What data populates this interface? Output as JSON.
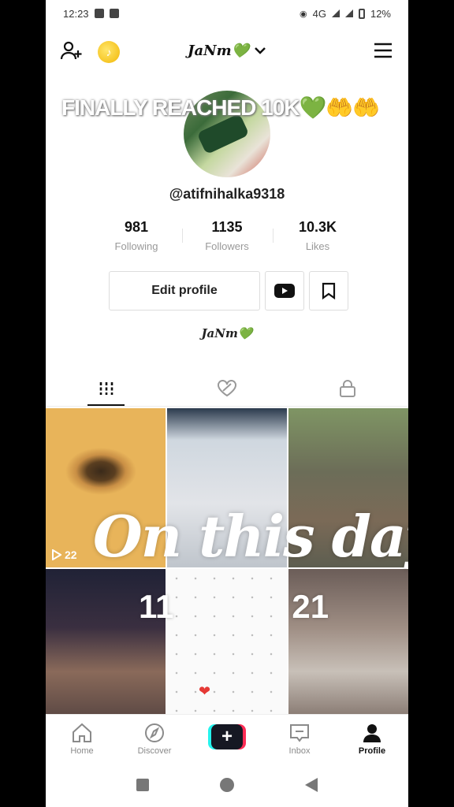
{
  "status_bar": {
    "time": "12:23",
    "network": "4G",
    "battery": "12%"
  },
  "header": {
    "title": "JaNm💚",
    "coin_label": "♪"
  },
  "banner": {
    "text": "FINALLY REACHED 10K",
    "green_emoji": "💚",
    "hands_emoji": "🤲🤲"
  },
  "profile": {
    "username": "@atifnihalka9318",
    "stats": [
      {
        "value": "981",
        "label": "Following"
      },
      {
        "value": "1135",
        "label": "Followers"
      },
      {
        "value": "10.3K",
        "label": "Likes"
      }
    ],
    "edit_label": "Edit profile",
    "bio": "JaNm💚"
  },
  "videos": [
    {
      "views": "22"
    },
    {
      "views": ""
    },
    {
      "views": ""
    },
    {
      "views": ""
    },
    {
      "views": ""
    },
    {
      "views": ""
    }
  ],
  "overlay": {
    "title": "On this day",
    "date_left": "11",
    "date_right": "21"
  },
  "nav": {
    "home": "Home",
    "discover": "Discover",
    "inbox": "Inbox",
    "profile": "Profile"
  },
  "colors": {
    "accent_red": "#fe2c55",
    "accent_cyan": "#25f4ee",
    "green": "#63c23a"
  }
}
